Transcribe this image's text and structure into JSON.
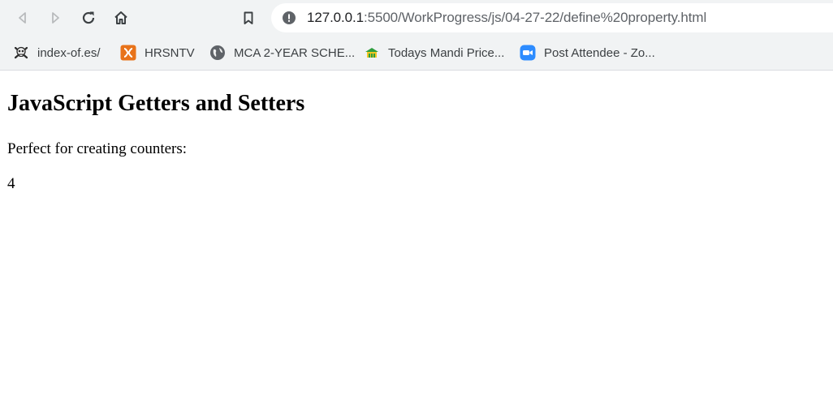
{
  "browser": {
    "url_host": "127.0.0.1",
    "url_rest": ":5500/WorkProgress/js/04-27-22/define%20property.html",
    "icons": {
      "back": "back-arrow-icon",
      "forward": "forward-arrow-icon",
      "reload": "reload-icon",
      "home": "home-icon",
      "bookmark": "bookmark-icon",
      "site_info": "info-alert-icon"
    }
  },
  "bookmarks": [
    {
      "label": "index-of.es/",
      "icon": "skull-crossbones-icon"
    },
    {
      "label": "HRSNTV",
      "icon": "xampp-logo-icon",
      "color": "#e8731a"
    },
    {
      "label": "MCA 2-YEAR SCHE...",
      "icon": "globe-icon"
    },
    {
      "label": "Todays Mandi Price...",
      "icon": "mandi-logo-icon",
      "color": "#2e9e3e"
    },
    {
      "label": "Post Attendee - Zo...",
      "icon": "zoom-camera-icon",
      "color": "#2d8cff"
    }
  ],
  "page": {
    "heading": "JavaScript Getters and Setters",
    "intro": "Perfect for creating counters:",
    "counter": "4"
  }
}
